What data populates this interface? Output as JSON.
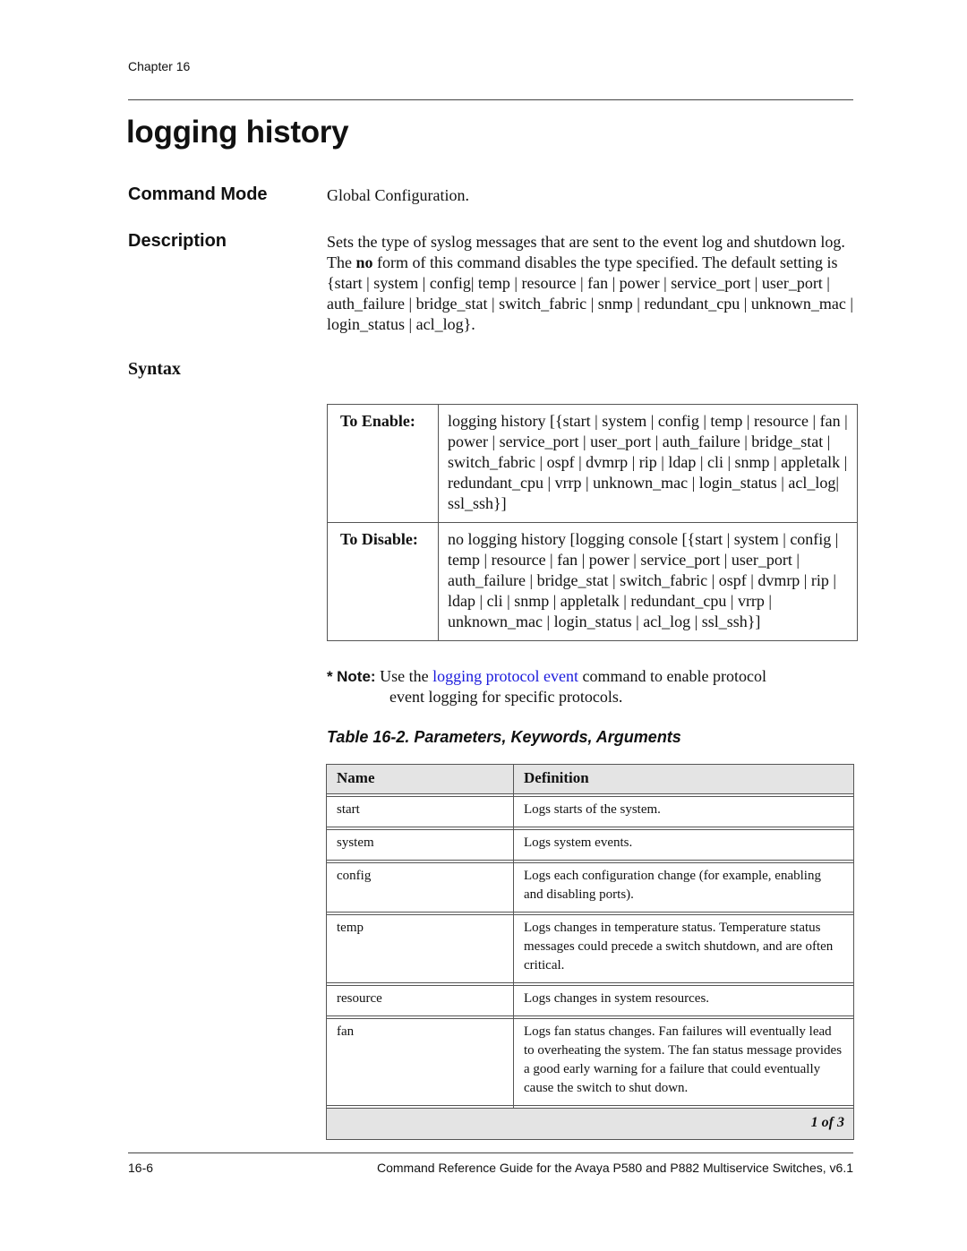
{
  "header": {
    "chapter": "Chapter 16"
  },
  "title": "logging history",
  "command_mode": {
    "label": "Command Mode",
    "value": "Global Configuration."
  },
  "description": {
    "label": "Description",
    "text_before_bold": "Sets the type of syslog messages that are sent to the event log and shutdown log. The ",
    "bold": "no",
    "text_after_bold": " form of this command disables the type specified. The default setting is {start | system | config| temp | resource | fan | power | service_port | user_port | auth_failure | bridge_stat | switch_fabric | snmp | redundant_cpu | unknown_mac | login_status | acl_log}."
  },
  "syntax": {
    "label": "Syntax",
    "rows": [
      {
        "label": "To Enable:",
        "value": "logging history [{start | system | config | temp | resource | fan | power | service_port | user_port | auth_failure | bridge_stat | switch_fabric | ospf | dvmrp | rip | ldap | cli | snmp | appletalk | redundant_cpu | vrrp | unknown_mac | login_status | acl_log| ssl_ssh}]"
      },
      {
        "label": "To Disable:",
        "value": "no logging history [logging console [{start | system | config | temp | resource | fan | power | service_port | user_port | auth_failure | bridge_stat | switch_fabric | ospf | dvmrp | rip | ldap | cli | snmp | appletalk | redundant_cpu | vrrp | unknown_mac | login_status | acl_log | ssl_ssh}]"
      }
    ]
  },
  "note": {
    "star": "*",
    "label": "Note:",
    "text_before_link": "Use the ",
    "link": "logging protocol event",
    "text_after_link": " command to enable protocol",
    "continuation": "event logging for specific protocols.",
    "link_color": "#1a1adc"
  },
  "params_table": {
    "caption": "Table 16-2.  Parameters, Keywords, Arguments",
    "headers": [
      "Name",
      "Definition"
    ],
    "rows": [
      {
        "name": "start",
        "definition": "Logs starts of the system."
      },
      {
        "name": "system",
        "definition": "Logs system events."
      },
      {
        "name": "config",
        "definition": "Logs each configuration change (for example, enabling and disabling ports)."
      },
      {
        "name": "temp",
        "definition": "Logs changes in temperature status. Temperature status messages could precede a switch shutdown, and are often critical."
      },
      {
        "name": "resource",
        "definition": "Logs changes in system resources."
      },
      {
        "name": "fan",
        "definition": "Logs fan status changes. Fan failures will eventually lead to overheating the system. The fan status message provides a good early warning for a failure that could eventually cause the switch to shut down."
      }
    ],
    "footer": "1 of 3"
  },
  "footer": {
    "page_number": "16-6",
    "guide_title": "Command Reference Guide for the Avaya P580 and P882 Multiservice Switches, v6.1"
  }
}
